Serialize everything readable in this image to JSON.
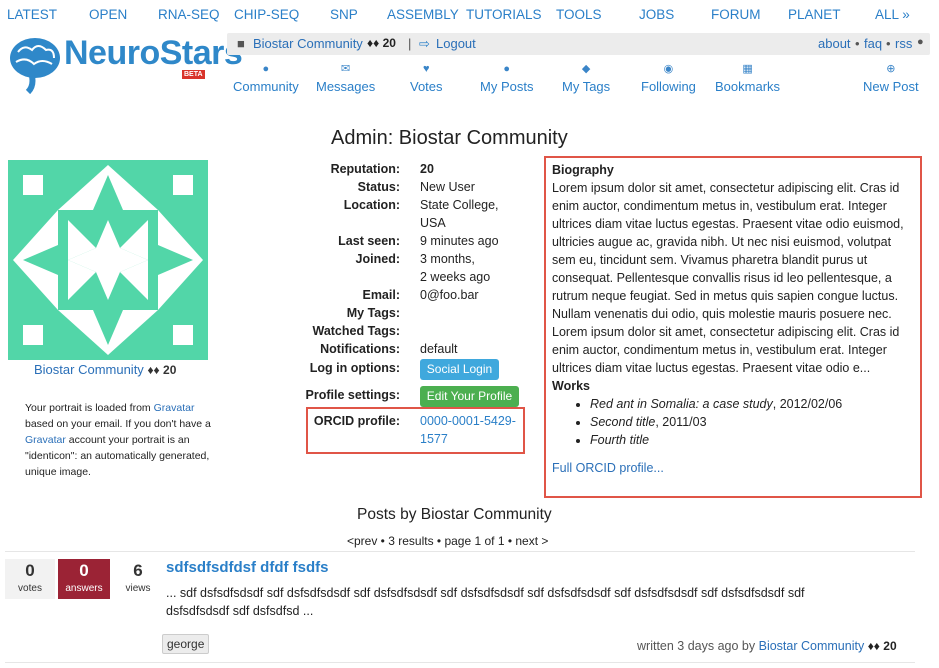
{
  "topnav": [
    "LATEST",
    "OPEN",
    "RNA-SEQ",
    "CHIP-SEQ",
    "SNP",
    "ASSEMBLY",
    "TUTORIALS",
    "TOOLS",
    "JOBS",
    "FORUM",
    "PLANET",
    "ALL »"
  ],
  "logo": {
    "text": "NeuroStars",
    "badge": "BETA"
  },
  "userbar": {
    "user": "Biostar Community",
    "badge": "♦♦ 20",
    "sep": "|",
    "logout": "Logout",
    "about": "about",
    "faq": "faq",
    "rss": "rss",
    "dot": "•"
  },
  "iconnav": [
    {
      "label": "Community",
      "icon": "globe-icon"
    },
    {
      "label": "Messages",
      "icon": "envelope-icon"
    },
    {
      "label": "Votes",
      "icon": "heart-icon"
    },
    {
      "label": "My Posts",
      "icon": "comments-icon"
    },
    {
      "label": "My Tags",
      "icon": "tag-icon"
    },
    {
      "label": "Following",
      "icon": "eye-icon"
    },
    {
      "label": "Bookmarks",
      "icon": "book-icon"
    },
    {
      "label": "New Post",
      "icon": "plus-circle-icon"
    }
  ],
  "page_title": "Admin: Biostar Community",
  "portrait": {
    "name": "Biostar Community",
    "badge": "♦♦ 20",
    "note_1": "Your portrait is loaded from ",
    "gravatar": "Gravatar",
    "note_2": " based on your email. If you don't have a ",
    "note_3": " account your portrait is an \"identicon\": an automatically generated, unique image.",
    "color": "#52d6a8"
  },
  "profile": {
    "reputation_label": "Reputation:",
    "reputation": "20",
    "status_label": "Status:",
    "status": "New User",
    "location_label": "Location:",
    "location_1": "State College,",
    "location_2": "USA",
    "last_seen_label": "Last seen:",
    "last_seen": "9 minutes ago",
    "joined_label": "Joined:",
    "joined_1": "3 months,",
    "joined_2": "2 weeks ago",
    "email_label": "Email:",
    "email": "0@foo.bar",
    "my_tags_label": "My Tags:",
    "watched_tags_label": "Watched Tags:",
    "notifications_label": "Notifications:",
    "notifications": "default",
    "login_options_label": "Log in options:",
    "social_login": "Social Login",
    "profile_settings_label": "Profile settings:",
    "edit_profile": "Edit Your Profile",
    "orcid_label": "ORCID profile:",
    "orcid_1": "0000-0001-5429-",
    "orcid_2": "1577"
  },
  "bio": {
    "heading": "Biography",
    "text": "Lorem ipsum dolor sit amet, consectetur adipiscing elit. Cras id enim auctor, condimentum metus in, vestibulum erat. Integer ultrices diam vitae luctus egestas. Praesent vitae odio euismod, ultricies augue ac, gravida nibh. Ut nec nisi euismod, volutpat sem eu, tincidunt sem. Vivamus pharetra blandit purus ut consequat. Pellentesque convallis risus id leo pellentesque, a rutrum neque feugiat. Sed in metus quis sapien congue luctus. Nullam venenatis dui odio, quis molestie mauris posuere nec. Lorem ipsum dolor sit amet, consectetur adipiscing elit. Cras id enim auctor, condimentum metus in, vestibulum erat. Integer ultrices diam vitae luctus egestas. Praesent vitae odio e...",
    "works_heading": "Works",
    "works": [
      {
        "title": "Red ant in Somalia: a case study",
        "date": ", 2012/02/06"
      },
      {
        "title": "Second title",
        "date": ", 2011/03"
      },
      {
        "title": "Fourth title",
        "date": ""
      }
    ],
    "full_link": "Full ORCID profile..."
  },
  "posts": {
    "heading": "Posts by Biostar Community",
    "pager": "<prev • 3 results • page 1 of 1 • next >",
    "items": [
      {
        "votes": "0",
        "votes_label": "votes",
        "answers": "0",
        "answers_label": "answers",
        "views": "6",
        "views_label": "views",
        "title": "sdfsdfsdfdsf dfdf fsdfs",
        "body": "... sdf dsfsdfsdsdf sdf dsfsdfsdsdf sdf dsfsdfsdsdf sdf dsfsdfsdsdf sdf dsfsdfsdsdf sdf dsfsdfsdsdf sdf dsfsdfsdsdf sdf dsfsdfsdsdf sdf dsfsdfsd ...",
        "tag": "george",
        "written": "written 3 days ago by ",
        "author": "Biostar Community",
        "author_badge": "♦♦ 20"
      }
    ]
  },
  "colors": {
    "link": "#2a7fc8",
    "answers_bg": "#9b2335",
    "highlight_box": "#e05547"
  }
}
